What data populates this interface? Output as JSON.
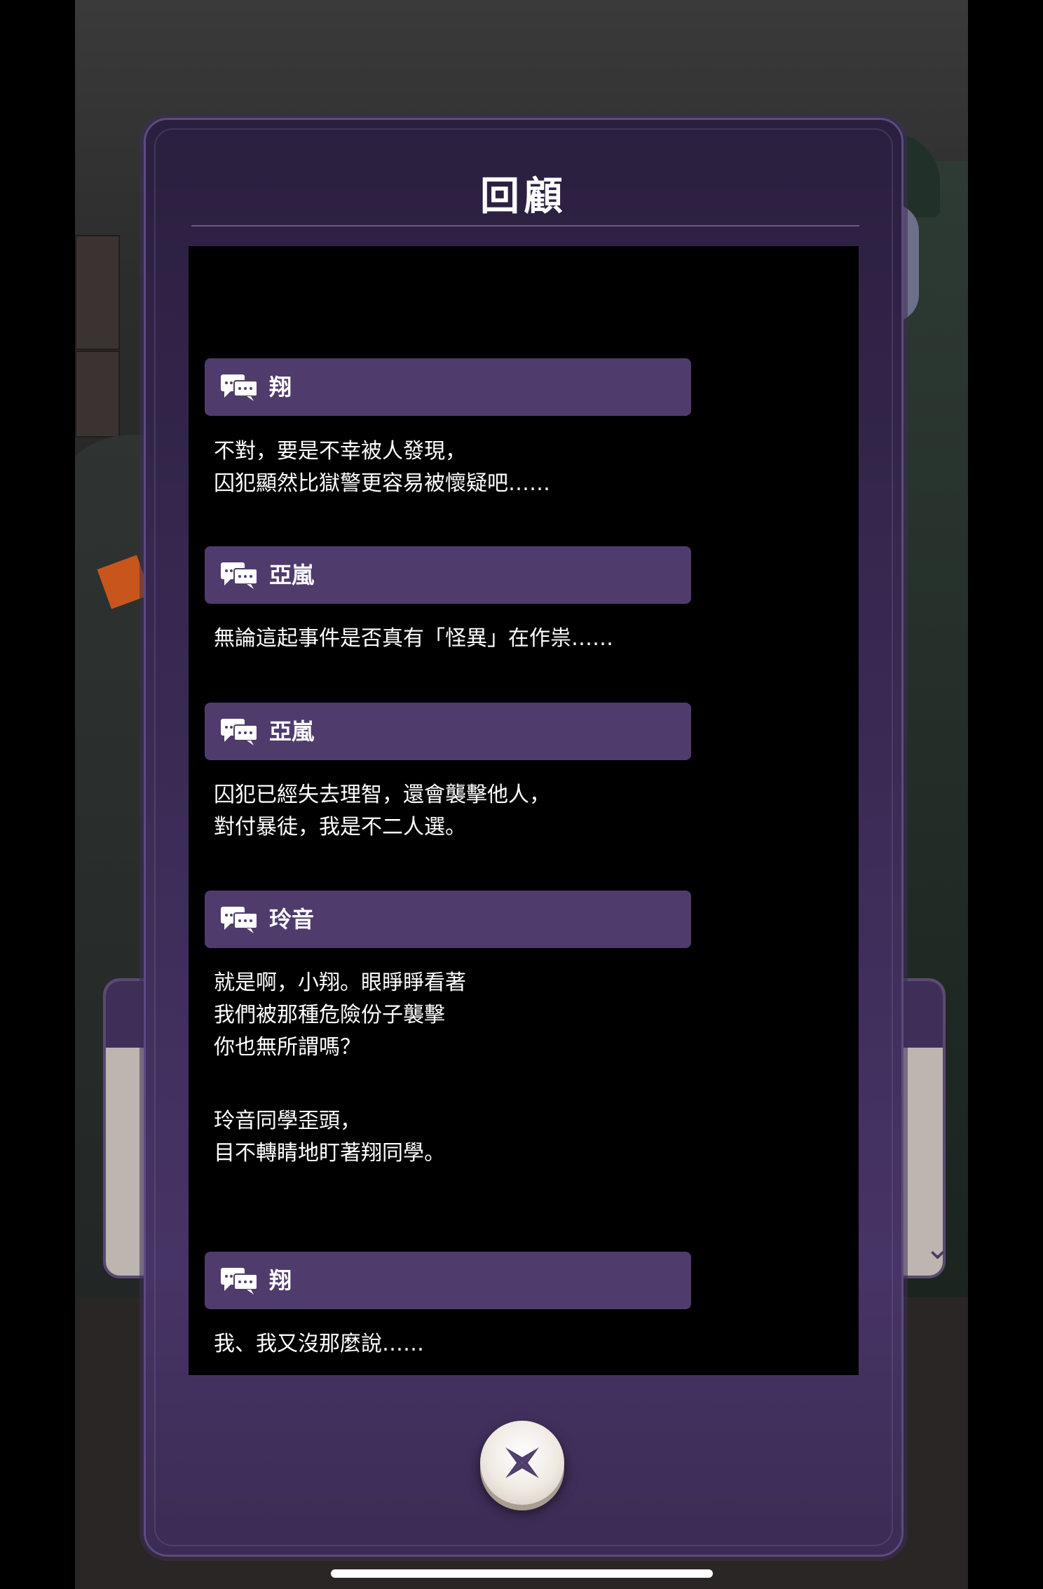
{
  "modal": {
    "title": "回顧"
  },
  "log": {
    "entries": [
      {
        "speaker": "翔",
        "lines": [
          "不對，要是不幸被人發現，",
          "囚犯顯然比獄警更容易被懷疑吧……"
        ]
      },
      {
        "speaker": "亞嵐",
        "lines": [
          "無論這起事件是否真有「怪異」在作祟……"
        ]
      },
      {
        "speaker": "亞嵐",
        "lines": [
          "囚犯已經失去理智，還會襲擊他人，",
          "對付暴徒，我是不二人選。"
        ]
      },
      {
        "speaker": "玲音",
        "lines": [
          "就是啊，小翔。眼睜睜看著",
          "我們被那種危險份子襲擊",
          "你也無所謂嗎？"
        ]
      },
      {
        "narration": true,
        "lines": [
          "玲音同學歪頭，",
          "目不轉睛地盯著翔同學。"
        ]
      },
      {
        "speaker": "翔",
        "lines": [
          "我、我又沒那麼說……"
        ]
      }
    ]
  },
  "colors": {
    "modal_bg": "#3a2b55",
    "speaker_bar": "#4f3c6c",
    "log_bg": "#000000",
    "text": "#ffffff"
  },
  "icons": {
    "speaker": "speech-bubbles-icon",
    "close": "close-x-icon"
  }
}
